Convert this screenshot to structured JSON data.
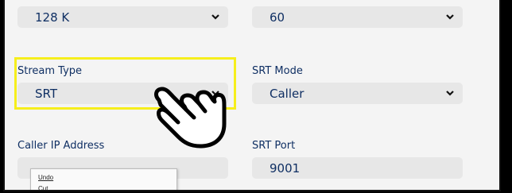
{
  "bitrate": {
    "value": "128 K"
  },
  "fps": {
    "value": "60"
  },
  "stream_type": {
    "label": "Stream Type",
    "value": "SRT"
  },
  "srt_mode": {
    "label": "SRT Mode",
    "value": "Caller"
  },
  "caller_ip": {
    "label": "Caller IP Address",
    "value": ""
  },
  "srt_port": {
    "label": "SRT Port",
    "value": "9001"
  },
  "context_menu": {
    "items": [
      "Undo",
      "Cut"
    ]
  },
  "colors": {
    "highlight": "#f6ee1c",
    "text": "#0f2f63",
    "field_bg": "#e7e7e7"
  },
  "icons": {
    "pointer": "hand-pointer-icon",
    "dropdown": "chevron-down-icon"
  }
}
